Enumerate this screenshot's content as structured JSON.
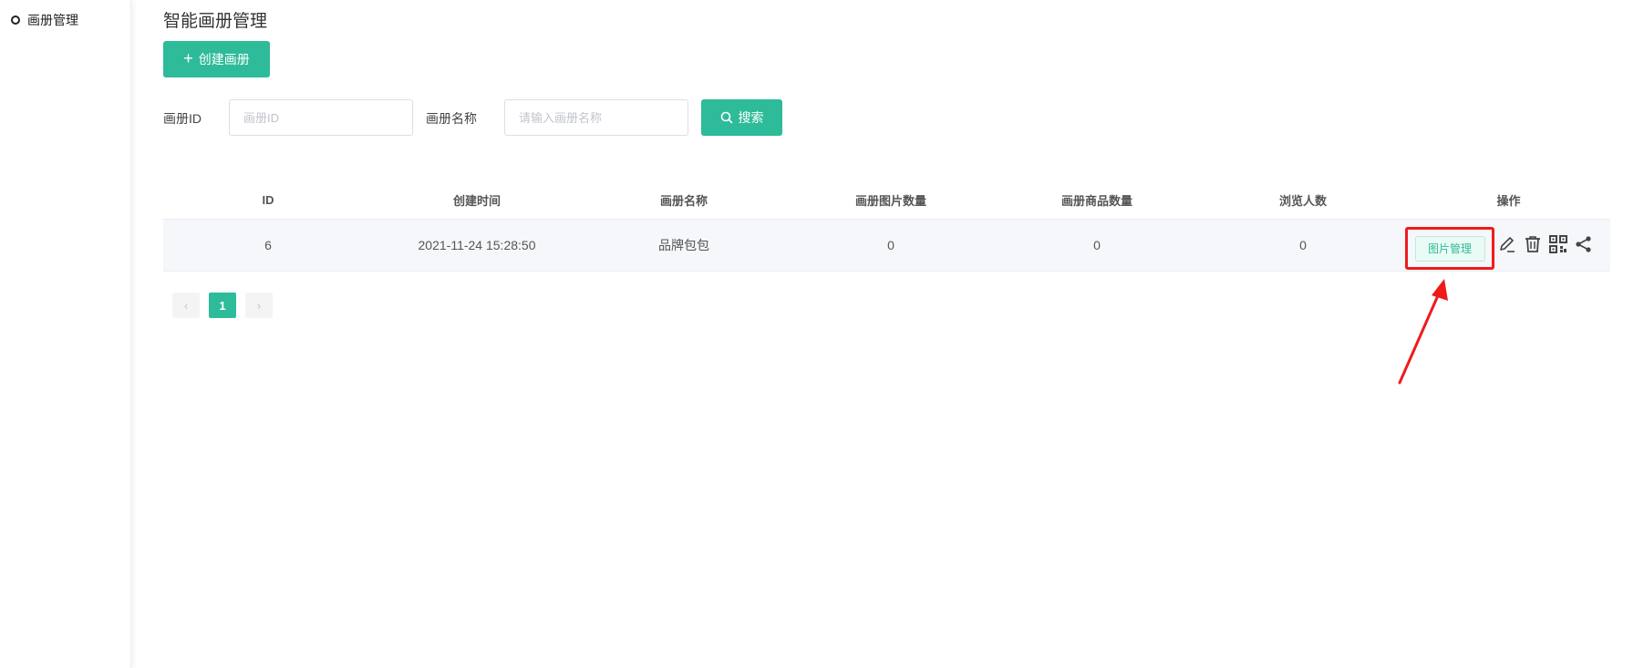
{
  "sidebar": {
    "items": [
      {
        "label": "画册管理"
      }
    ]
  },
  "header": {
    "title": "智能画册管理"
  },
  "toolbar": {
    "create_label": "创建画册"
  },
  "filters": {
    "id_label": "画册ID",
    "id_placeholder": "画册ID",
    "name_label": "画册名称",
    "name_placeholder": "请输入画册名称",
    "search_label": "搜索"
  },
  "table": {
    "columns": [
      "ID",
      "创建时间",
      "画册名称",
      "画册图片数量",
      "画册商品数量",
      "浏览人数",
      "操作"
    ],
    "rows": [
      {
        "id": "6",
        "created": "2021-11-24 15:28:50",
        "name": "品牌包包",
        "image_count": "0",
        "product_count": "0",
        "views": "0",
        "image_manage_label": "图片管理"
      }
    ]
  },
  "pagination": {
    "prev": "‹",
    "current": "1",
    "next": "›"
  },
  "colors": {
    "accent": "#2ebb99",
    "highlight": "#ee1b1b"
  }
}
